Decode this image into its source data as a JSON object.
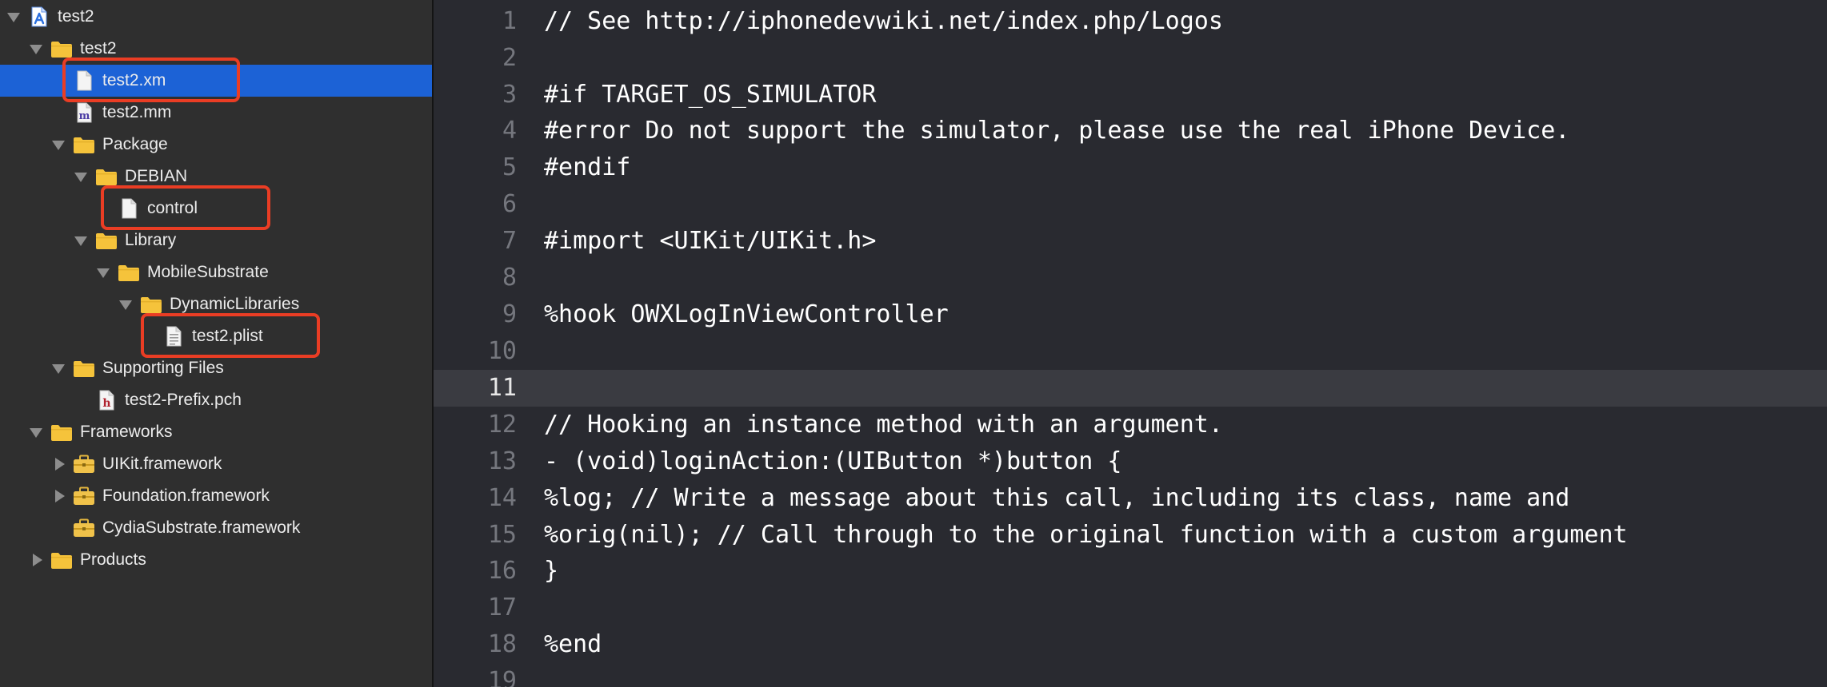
{
  "navigator": {
    "items": [
      {
        "label": "test2",
        "icon": "xcode-project-icon",
        "state": "open"
      },
      {
        "label": "test2",
        "icon": "folder-icon",
        "state": "open"
      },
      {
        "label": "test2.xm",
        "icon": "file-icon",
        "state": "none"
      },
      {
        "label": "test2.mm",
        "icon": "objc-source-file-icon",
        "state": "none"
      },
      {
        "label": "Package",
        "icon": "folder-icon",
        "state": "open"
      },
      {
        "label": "DEBIAN",
        "icon": "folder-icon",
        "state": "open"
      },
      {
        "label": "control",
        "icon": "file-icon",
        "state": "none"
      },
      {
        "label": "Library",
        "icon": "folder-icon",
        "state": "open"
      },
      {
        "label": "MobileSubstrate",
        "icon": "folder-icon",
        "state": "open"
      },
      {
        "label": "DynamicLibraries",
        "icon": "folder-icon",
        "state": "open"
      },
      {
        "label": "test2.plist",
        "icon": "plist-file-icon",
        "state": "none"
      },
      {
        "label": "Supporting Files",
        "icon": "folder-icon",
        "state": "open"
      },
      {
        "label": "test2-Prefix.pch",
        "icon": "header-file-icon",
        "state": "none"
      },
      {
        "label": "Frameworks",
        "icon": "folder-icon",
        "state": "open"
      },
      {
        "label": "UIKit.framework",
        "icon": "framework-icon",
        "state": "closed"
      },
      {
        "label": "Foundation.framework",
        "icon": "framework-icon",
        "state": "closed"
      },
      {
        "label": "CydiaSubstrate.framework",
        "icon": "framework-icon",
        "state": "none"
      },
      {
        "label": "Products",
        "icon": "folder-icon",
        "state": "closed"
      }
    ]
  },
  "editor": {
    "lines": [
      {
        "number": "1",
        "text": "// See http://iphonedevwiki.net/index.php/Logos"
      },
      {
        "number": "2",
        "text": ""
      },
      {
        "number": "3",
        "text": "#if TARGET_OS_SIMULATOR"
      },
      {
        "number": "4",
        "text": "#error Do not support the simulator, please use the real iPhone Device."
      },
      {
        "number": "5",
        "text": "#endif"
      },
      {
        "number": "6",
        "text": ""
      },
      {
        "number": "7",
        "text": "#import <UIKit/UIKit.h>"
      },
      {
        "number": "8",
        "text": ""
      },
      {
        "number": "9",
        "text": "%hook OWXLogInViewController"
      },
      {
        "number": "10",
        "text": ""
      },
      {
        "number": "11",
        "text": ""
      },
      {
        "number": "12",
        "text": "// Hooking an instance method with an argument."
      },
      {
        "number": "13",
        "text": "- (void)loginAction:(UIButton *)button {"
      },
      {
        "number": "14",
        "text": "%log; // Write a message about this call, including its class, name and"
      },
      {
        "number": "15",
        "text": "%orig(nil); // Call through to the original function with a custom argument"
      },
      {
        "number": "16",
        "text": "}"
      },
      {
        "number": "17",
        "text": ""
      },
      {
        "number": "18",
        "text": "%end"
      },
      {
        "number": "19",
        "text": ""
      }
    ]
  },
  "colors": {
    "selection": "#1c62d6",
    "annotation": "#ea3d24",
    "folder": "#f5c33b",
    "editor_background": "#292a30",
    "sidebar_background": "#2f2f2f",
    "current_line": "#3a3b41"
  }
}
